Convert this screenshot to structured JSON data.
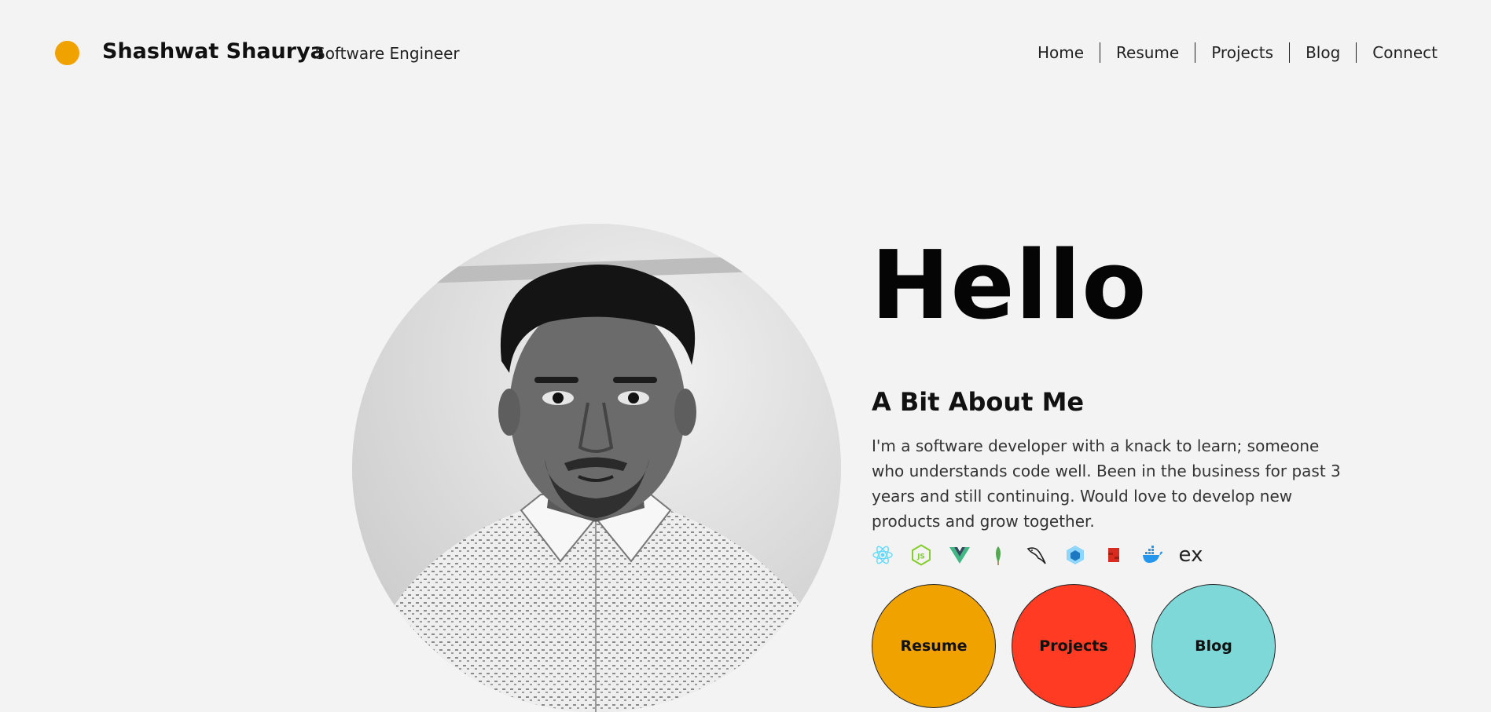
{
  "header": {
    "brand_name": "Shashwat Shaurya",
    "brand_role": "Software Engineer",
    "logo_color": "#f0a200"
  },
  "nav": {
    "items": [
      "Home",
      "Resume",
      "Projects",
      "Blog",
      "Connect"
    ]
  },
  "hero": {
    "greeting": "Hello",
    "about_title": "A Bit About Me",
    "about_text": "I'm a software developer with a knack to learn; someone who understands code well. Been in the business for past 3 years and still continuing. Would love to develop new products and grow together.",
    "tech_icons": [
      "react-icon",
      "nodejs-icon",
      "vue-icon",
      "mongodb-icon",
      "mysql-icon",
      "webpack-icon",
      "redis-icon",
      "docker-icon",
      "express-icon"
    ],
    "express_label": "ex"
  },
  "actions": {
    "resume_label": "Resume",
    "projects_label": "Projects",
    "blog_label": "Blog",
    "colors": {
      "resume": "#f0a200",
      "projects": "#ff3b24",
      "blog": "#7ed8d8"
    }
  }
}
